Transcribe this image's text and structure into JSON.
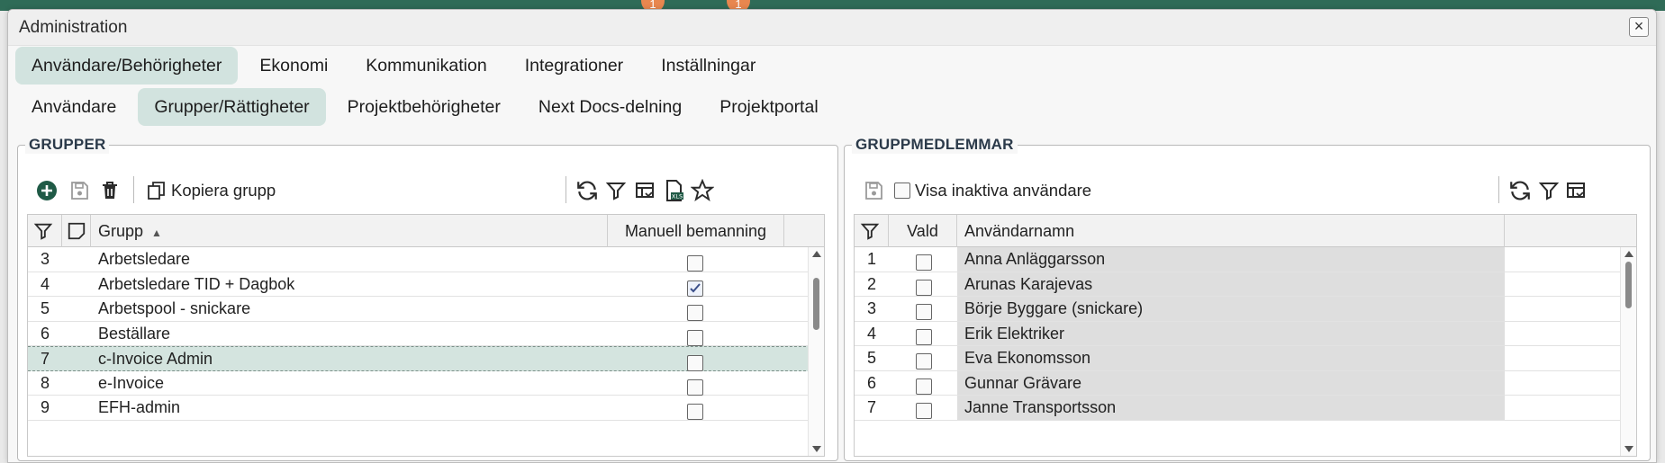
{
  "background": {
    "badge_left": "1",
    "badge_right": "1"
  },
  "window": {
    "title": "Administration",
    "close": "×"
  },
  "main_tabs": [
    {
      "label": "Användare/Behörigheter",
      "active": true
    },
    {
      "label": "Ekonomi",
      "active": false
    },
    {
      "label": "Kommunikation",
      "active": false
    },
    {
      "label": "Integrationer",
      "active": false
    },
    {
      "label": "Inställningar",
      "active": false
    }
  ],
  "sub_tabs": [
    {
      "label": "Användare",
      "active": false
    },
    {
      "label": "Grupper/Rättigheter",
      "active": true
    },
    {
      "label": "Projektbehörigheter",
      "active": false
    },
    {
      "label": "Next Docs-delning",
      "active": false
    },
    {
      "label": "Projektportal",
      "active": false
    }
  ],
  "groups_panel": {
    "legend": "GRUPPER",
    "copy_label": "Kopiera grupp",
    "columns": {
      "group": "Grupp",
      "sort_indicator": "▲",
      "manual": "Manuell bemanning"
    },
    "rows": [
      {
        "num": "3",
        "name": "Arbetsledare",
        "manual": false,
        "selected": false
      },
      {
        "num": "4",
        "name": "Arbetsledare TID + Dagbok",
        "manual": true,
        "selected": false
      },
      {
        "num": "5",
        "name": "Arbetspool - snickare",
        "manual": false,
        "selected": false
      },
      {
        "num": "6",
        "name": "Beställare",
        "manual": false,
        "selected": false
      },
      {
        "num": "7",
        "name": "c-Invoice Admin",
        "manual": false,
        "selected": true
      },
      {
        "num": "8",
        "name": "e-Invoice",
        "manual": false,
        "selected": false
      },
      {
        "num": "9",
        "name": "EFH-admin",
        "manual": false,
        "selected": false
      }
    ]
  },
  "members_panel": {
    "legend": "GRUPPMEDLEMMAR",
    "inactive_label": "Visa inaktiva användare",
    "columns": {
      "selected": "Vald",
      "username": "Användarnamn"
    },
    "rows": [
      {
        "num": "1",
        "name": "Anna Anläggarsson",
        "checked": false
      },
      {
        "num": "2",
        "name": "Arunas Karajevas",
        "checked": false
      },
      {
        "num": "3",
        "name": "Börje Byggare (snickare)",
        "checked": false
      },
      {
        "num": "4",
        "name": "Erik Elektriker",
        "checked": false
      },
      {
        "num": "5",
        "name": "Eva Ekonomsson",
        "checked": false
      },
      {
        "num": "6",
        "name": "Gunnar Grävare",
        "checked": false
      },
      {
        "num": "7",
        "name": "Janne Transportsson",
        "checked": false
      }
    ]
  },
  "colors": {
    "accent": "#1f5a46",
    "tab_active": "#d2e3df",
    "selected_row": "#d4e4df",
    "member_row": "#dedede"
  }
}
